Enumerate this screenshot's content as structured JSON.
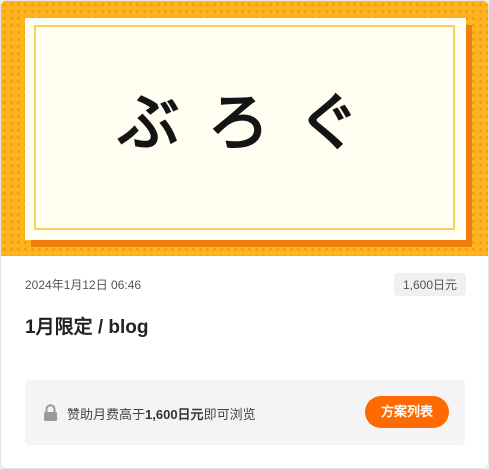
{
  "cover": {
    "title": "ぶろぐ",
    "colors": {
      "background": "#ffb41f",
      "dots": "#f49a12",
      "shadow": "#f07d10",
      "paper": "#fffef0",
      "frame": "#f7d060"
    }
  },
  "post": {
    "date": "2024年1月12日 06:46",
    "price": "1,600日元",
    "title": "1月限定 / blog"
  },
  "lock": {
    "icon": "lock-icon",
    "text_prefix": "赞助月费高于",
    "text_amount": "1,600日元",
    "text_suffix": "即可浏览",
    "button_label": "方案列表",
    "button_color": "#ff6a00"
  }
}
